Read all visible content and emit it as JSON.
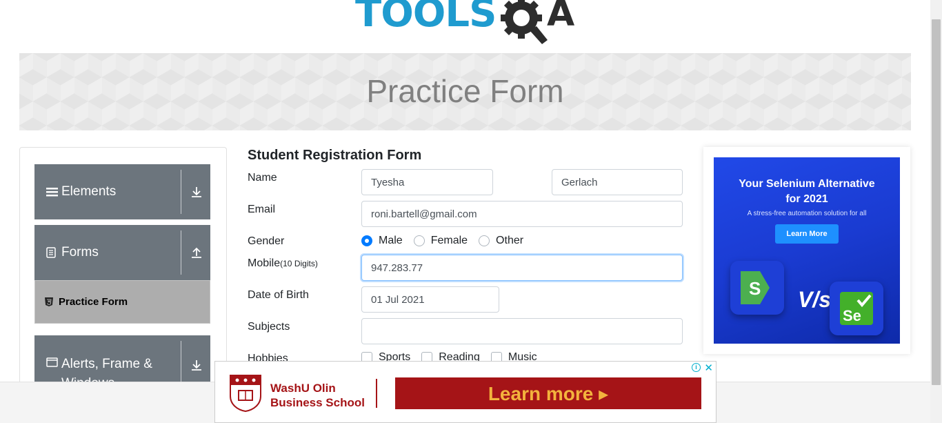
{
  "header": {
    "logo_text": "TOOLS",
    "logo_a": "A"
  },
  "banner": {
    "title": "Practice Form"
  },
  "sidebar": {
    "groups": [
      {
        "label": "Elements",
        "icon": "hamburger-icon",
        "arrow": "download-icon"
      },
      {
        "label": "Forms",
        "icon": "document-icon",
        "arrow": "upload-icon"
      },
      {
        "label": "Alerts, Frame &",
        "label2": "Windows",
        "icon": "window-icon",
        "arrow": "download-icon"
      }
    ],
    "active_item": {
      "label": "Practice Form",
      "icon": "html5-icon"
    }
  },
  "form": {
    "title": "Student Registration Form",
    "name_label": "Name",
    "first_name": "Tyesha",
    "last_name": "Gerlach",
    "email_label": "Email",
    "email": "roni.bartell@gmail.com",
    "gender_label": "Gender",
    "gender_options": [
      "Male",
      "Female",
      "Other"
    ],
    "gender_selected": "Male",
    "mobile_label": "Mobile",
    "mobile_hint": "(10 Digits)",
    "mobile": "947.283.77",
    "dob_label": "Date of Birth",
    "dob": "01 Jul 2021",
    "subjects_label": "Subjects",
    "subjects": "",
    "hobbies_label": "Hobbies",
    "hobbies": [
      "Sports",
      "Reading",
      "Music"
    ]
  },
  "ad_right": {
    "headline": "Your Selenium Alternative",
    "headline2": "for 2021",
    "sub": "A stress-free automation solution for all",
    "button": "Learn More",
    "vs": "V/s",
    "tile_left": "S",
    "tile_right": "Se"
  },
  "ad_bottom": {
    "line1": "WashU Olin",
    "line2": "Business School",
    "cta": "Learn more ▸",
    "brand_color": "#a51417",
    "cta_text_color": "#f3b33d"
  },
  "colors": {
    "logo_blue": "#1f9bcf",
    "sidebar_group": "#6c757d",
    "sidebar_active": "#adadad",
    "radio_selected": "#007bff"
  }
}
